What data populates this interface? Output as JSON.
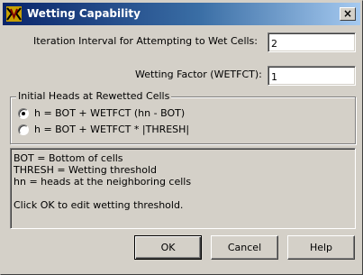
{
  "window": {
    "title": "Wetting Capability",
    "close_glyph": "×",
    "app_icon": "modflow-app-icon"
  },
  "form": {
    "iteration_label": "Iteration Interval for Attempting to Wet Cells:",
    "iteration_value": "2",
    "wetting_factor_label": "Wetting Factor (WETFCT):",
    "wetting_factor_value": "1"
  },
  "initial_heads": {
    "legend": "Initial Heads at Rewetted Cells",
    "options": [
      {
        "label": "h = BOT + WETFCT (hn - BOT)",
        "selected": true
      },
      {
        "label": "h = BOT + WETFCT * |THRESH|",
        "selected": false
      }
    ]
  },
  "info": {
    "lines": [
      "BOT = Bottom of cells",
      "THRESH = Wetting threshold",
      "hn = heads at the neighboring cells",
      "",
      "Click OK to edit wetting threshold."
    ]
  },
  "buttons": {
    "ok": "OK",
    "cancel": "Cancel",
    "help": "Help"
  }
}
